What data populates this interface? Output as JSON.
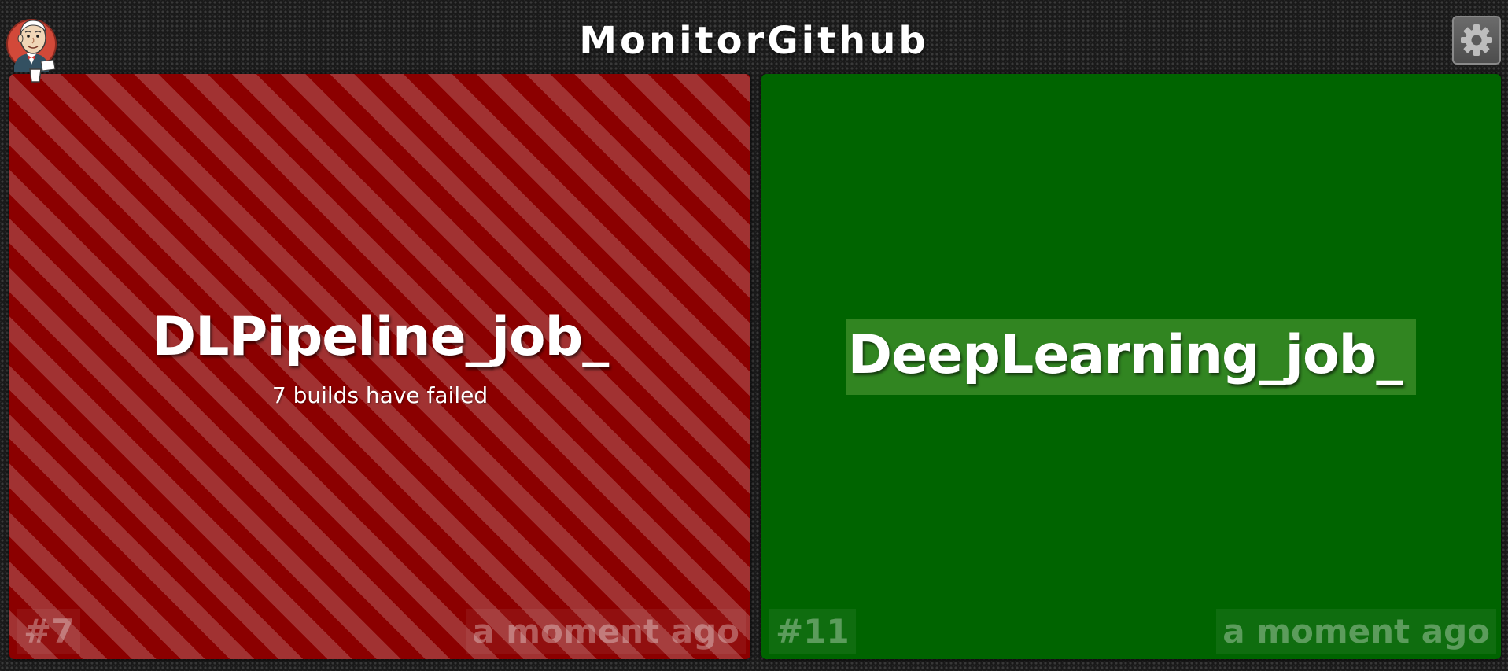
{
  "header": {
    "title": "MonitorGithub",
    "logo_icon": "jenkins-butler-logo-icon",
    "settings_icon": "gear-icon"
  },
  "jobs": [
    {
      "name": "DLPipeline_job_",
      "status": "failed",
      "status_text": "7 builds have failed",
      "build_number": "#7",
      "time_ago": "a moment ago",
      "color": "#8b0000",
      "stripe_color": "#a13232"
    },
    {
      "name": "DeepLearning_job_",
      "status": "success",
      "build_number": "#11",
      "time_ago": "a moment ago",
      "color": "#006400"
    }
  ]
}
